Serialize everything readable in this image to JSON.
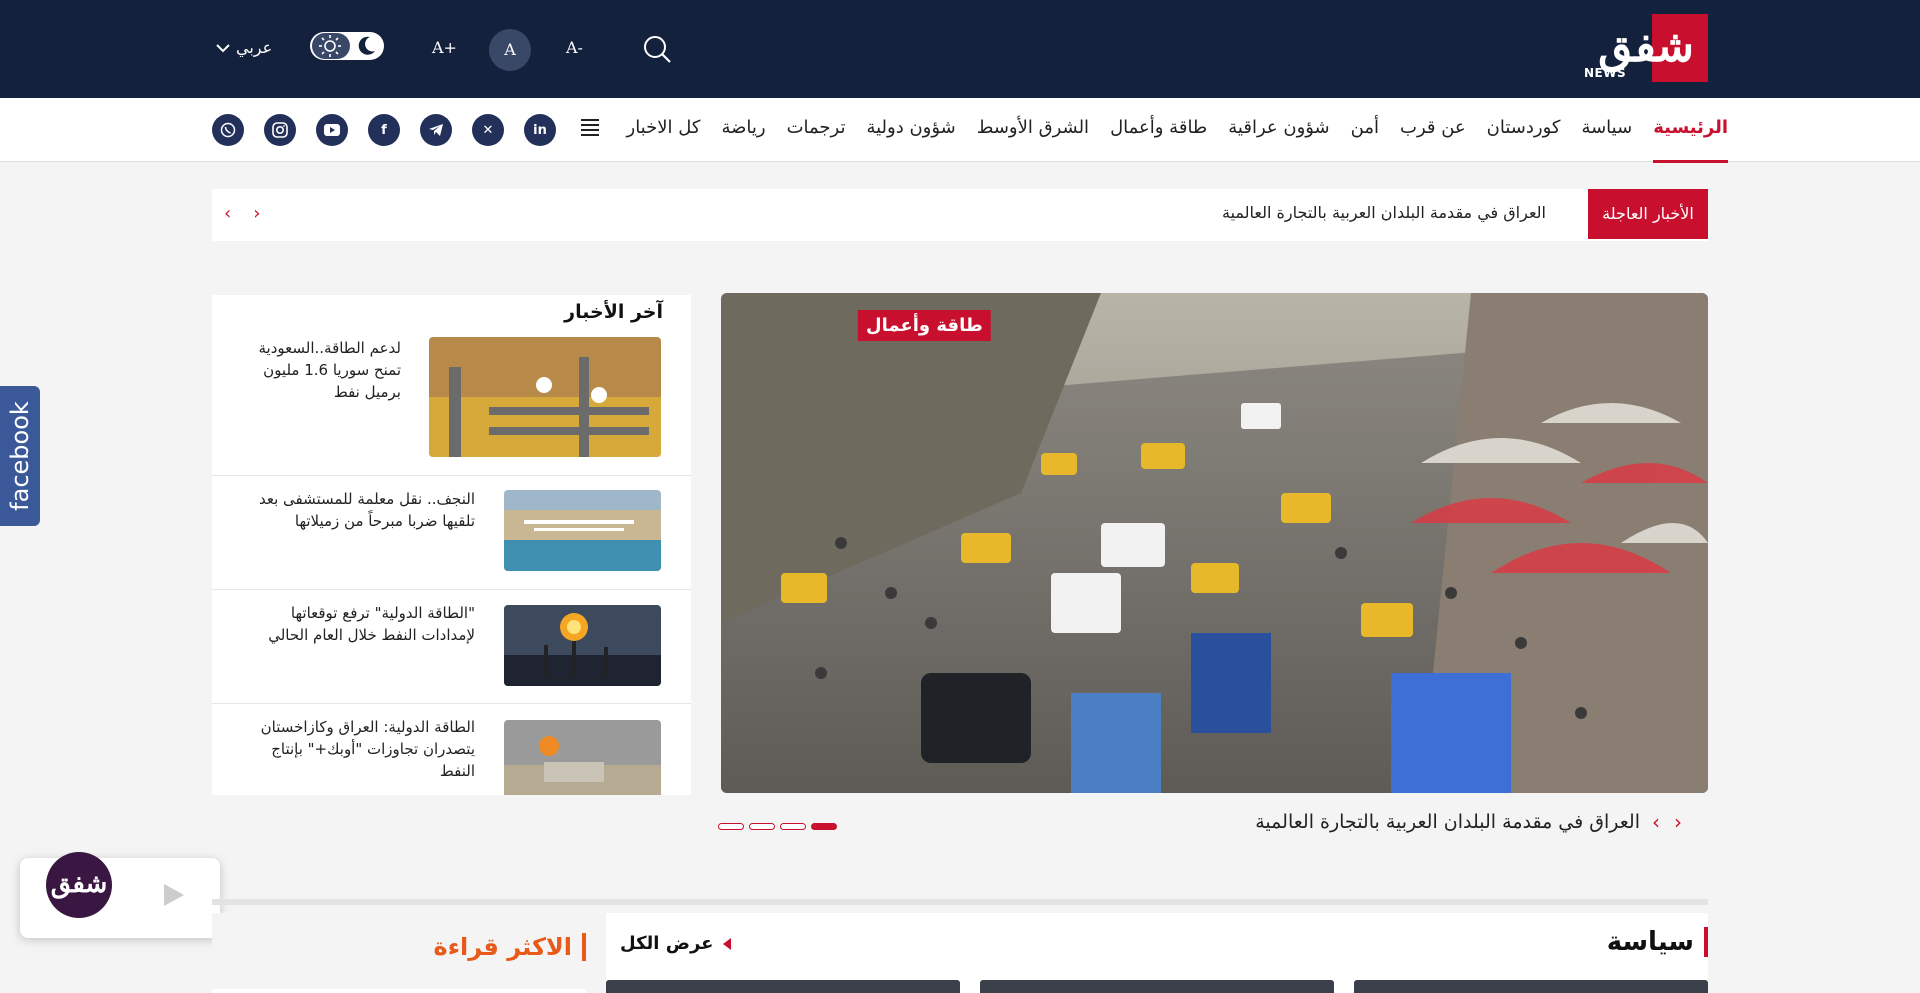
{
  "header": {
    "logo_text": "شفق",
    "logo_sub": "NEWS",
    "font_decrease": "A-",
    "font_reset": "A",
    "font_increase": "A+",
    "language": "عربي"
  },
  "nav": {
    "items": [
      {
        "label": "الرئيسية",
        "active": true
      },
      {
        "label": "سياسة"
      },
      {
        "label": "كوردستان"
      },
      {
        "label": "عن قرب"
      },
      {
        "label": "أمن"
      },
      {
        "label": "شؤون عراقية"
      },
      {
        "label": "طاقة وأعمال"
      },
      {
        "label": "الشرق الأوسط"
      },
      {
        "label": "شؤون دولية"
      },
      {
        "label": "ترجمات"
      },
      {
        "label": "رياضة"
      },
      {
        "label": "كل الاخبار"
      }
    ],
    "socials": [
      "linkedin-icon",
      "x-icon",
      "telegram-icon",
      "facebook-icon",
      "youtube-icon",
      "instagram-icon",
      "whatsapp-icon"
    ]
  },
  "breaking": {
    "label": "الأخبار العاجلة",
    "headline": "العراق في مقدمة البلدان العربية بالتجارة العالمية"
  },
  "hero": {
    "category": "طاقة وأعمال",
    "caption": "العراق في مقدمة البلدان العربية بالتجارة العالمية",
    "slides": 4,
    "active_slide": 4
  },
  "latest": {
    "title": "آخر الأخبار",
    "items": [
      {
        "text": "لدعم الطاقة..السعودية تمنح سوريا 1.6 مليون برميل نفط"
      },
      {
        "text": "النجف.. نقل معلمة للمستشفى بعد تلقيها ضربا مبرحاً من زميلاتها"
      },
      {
        "text": "\"الطاقة الدولية\" ترفع توقعاتها لإمدادات النفط خلال العام الحالي"
      },
      {
        "text": "الطاقة الدولية: العراق وكازاخستان يتصدران تجاوزات \"أوبك+\" بإنتاج النفط"
      }
    ]
  },
  "side": {
    "facebook_label": "facebook"
  },
  "sections": {
    "politics_title": "سياسة",
    "view_all": "عرض الكل",
    "most_read_title": "الاكثر قراءة"
  },
  "colors": {
    "primary": "#14213d",
    "accent": "#c8102e",
    "most_read": "#e85a1a"
  }
}
